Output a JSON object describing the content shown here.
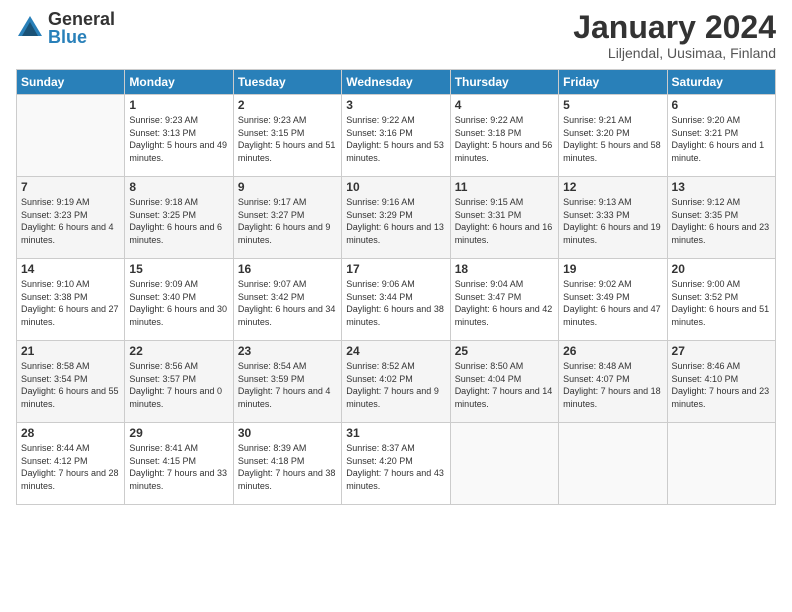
{
  "logo": {
    "general": "General",
    "blue": "Blue"
  },
  "header": {
    "month": "January 2024",
    "location": "Liljendal, Uusimaa, Finland"
  },
  "weekdays": [
    "Sunday",
    "Monday",
    "Tuesday",
    "Wednesday",
    "Thursday",
    "Friday",
    "Saturday"
  ],
  "weeks": [
    [
      {
        "day": "",
        "sunrise": "",
        "sunset": "",
        "daylight": ""
      },
      {
        "day": "1",
        "sunrise": "Sunrise: 9:23 AM",
        "sunset": "Sunset: 3:13 PM",
        "daylight": "Daylight: 5 hours and 49 minutes."
      },
      {
        "day": "2",
        "sunrise": "Sunrise: 9:23 AM",
        "sunset": "Sunset: 3:15 PM",
        "daylight": "Daylight: 5 hours and 51 minutes."
      },
      {
        "day": "3",
        "sunrise": "Sunrise: 9:22 AM",
        "sunset": "Sunset: 3:16 PM",
        "daylight": "Daylight: 5 hours and 53 minutes."
      },
      {
        "day": "4",
        "sunrise": "Sunrise: 9:22 AM",
        "sunset": "Sunset: 3:18 PM",
        "daylight": "Daylight: 5 hours and 56 minutes."
      },
      {
        "day": "5",
        "sunrise": "Sunrise: 9:21 AM",
        "sunset": "Sunset: 3:20 PM",
        "daylight": "Daylight: 5 hours and 58 minutes."
      },
      {
        "day": "6",
        "sunrise": "Sunrise: 9:20 AM",
        "sunset": "Sunset: 3:21 PM",
        "daylight": "Daylight: 6 hours and 1 minute."
      }
    ],
    [
      {
        "day": "7",
        "sunrise": "Sunrise: 9:19 AM",
        "sunset": "Sunset: 3:23 PM",
        "daylight": "Daylight: 6 hours and 4 minutes."
      },
      {
        "day": "8",
        "sunrise": "Sunrise: 9:18 AM",
        "sunset": "Sunset: 3:25 PM",
        "daylight": "Daylight: 6 hours and 6 minutes."
      },
      {
        "day": "9",
        "sunrise": "Sunrise: 9:17 AM",
        "sunset": "Sunset: 3:27 PM",
        "daylight": "Daylight: 6 hours and 9 minutes."
      },
      {
        "day": "10",
        "sunrise": "Sunrise: 9:16 AM",
        "sunset": "Sunset: 3:29 PM",
        "daylight": "Daylight: 6 hours and 13 minutes."
      },
      {
        "day": "11",
        "sunrise": "Sunrise: 9:15 AM",
        "sunset": "Sunset: 3:31 PM",
        "daylight": "Daylight: 6 hours and 16 minutes."
      },
      {
        "day": "12",
        "sunrise": "Sunrise: 9:13 AM",
        "sunset": "Sunset: 3:33 PM",
        "daylight": "Daylight: 6 hours and 19 minutes."
      },
      {
        "day": "13",
        "sunrise": "Sunrise: 9:12 AM",
        "sunset": "Sunset: 3:35 PM",
        "daylight": "Daylight: 6 hours and 23 minutes."
      }
    ],
    [
      {
        "day": "14",
        "sunrise": "Sunrise: 9:10 AM",
        "sunset": "Sunset: 3:38 PM",
        "daylight": "Daylight: 6 hours and 27 minutes."
      },
      {
        "day": "15",
        "sunrise": "Sunrise: 9:09 AM",
        "sunset": "Sunset: 3:40 PM",
        "daylight": "Daylight: 6 hours and 30 minutes."
      },
      {
        "day": "16",
        "sunrise": "Sunrise: 9:07 AM",
        "sunset": "Sunset: 3:42 PM",
        "daylight": "Daylight: 6 hours and 34 minutes."
      },
      {
        "day": "17",
        "sunrise": "Sunrise: 9:06 AM",
        "sunset": "Sunset: 3:44 PM",
        "daylight": "Daylight: 6 hours and 38 minutes."
      },
      {
        "day": "18",
        "sunrise": "Sunrise: 9:04 AM",
        "sunset": "Sunset: 3:47 PM",
        "daylight": "Daylight: 6 hours and 42 minutes."
      },
      {
        "day": "19",
        "sunrise": "Sunrise: 9:02 AM",
        "sunset": "Sunset: 3:49 PM",
        "daylight": "Daylight: 6 hours and 47 minutes."
      },
      {
        "day": "20",
        "sunrise": "Sunrise: 9:00 AM",
        "sunset": "Sunset: 3:52 PM",
        "daylight": "Daylight: 6 hours and 51 minutes."
      }
    ],
    [
      {
        "day": "21",
        "sunrise": "Sunrise: 8:58 AM",
        "sunset": "Sunset: 3:54 PM",
        "daylight": "Daylight: 6 hours and 55 minutes."
      },
      {
        "day": "22",
        "sunrise": "Sunrise: 8:56 AM",
        "sunset": "Sunset: 3:57 PM",
        "daylight": "Daylight: 7 hours and 0 minutes."
      },
      {
        "day": "23",
        "sunrise": "Sunrise: 8:54 AM",
        "sunset": "Sunset: 3:59 PM",
        "daylight": "Daylight: 7 hours and 4 minutes."
      },
      {
        "day": "24",
        "sunrise": "Sunrise: 8:52 AM",
        "sunset": "Sunset: 4:02 PM",
        "daylight": "Daylight: 7 hours and 9 minutes."
      },
      {
        "day": "25",
        "sunrise": "Sunrise: 8:50 AM",
        "sunset": "Sunset: 4:04 PM",
        "daylight": "Daylight: 7 hours and 14 minutes."
      },
      {
        "day": "26",
        "sunrise": "Sunrise: 8:48 AM",
        "sunset": "Sunset: 4:07 PM",
        "daylight": "Daylight: 7 hours and 18 minutes."
      },
      {
        "day": "27",
        "sunrise": "Sunrise: 8:46 AM",
        "sunset": "Sunset: 4:10 PM",
        "daylight": "Daylight: 7 hours and 23 minutes."
      }
    ],
    [
      {
        "day": "28",
        "sunrise": "Sunrise: 8:44 AM",
        "sunset": "Sunset: 4:12 PM",
        "daylight": "Daylight: 7 hours and 28 minutes."
      },
      {
        "day": "29",
        "sunrise": "Sunrise: 8:41 AM",
        "sunset": "Sunset: 4:15 PM",
        "daylight": "Daylight: 7 hours and 33 minutes."
      },
      {
        "day": "30",
        "sunrise": "Sunrise: 8:39 AM",
        "sunset": "Sunset: 4:18 PM",
        "daylight": "Daylight: 7 hours and 38 minutes."
      },
      {
        "day": "31",
        "sunrise": "Sunrise: 8:37 AM",
        "sunset": "Sunset: 4:20 PM",
        "daylight": "Daylight: 7 hours and 43 minutes."
      },
      {
        "day": "",
        "sunrise": "",
        "sunset": "",
        "daylight": ""
      },
      {
        "day": "",
        "sunrise": "",
        "sunset": "",
        "daylight": ""
      },
      {
        "day": "",
        "sunrise": "",
        "sunset": "",
        "daylight": ""
      }
    ]
  ]
}
